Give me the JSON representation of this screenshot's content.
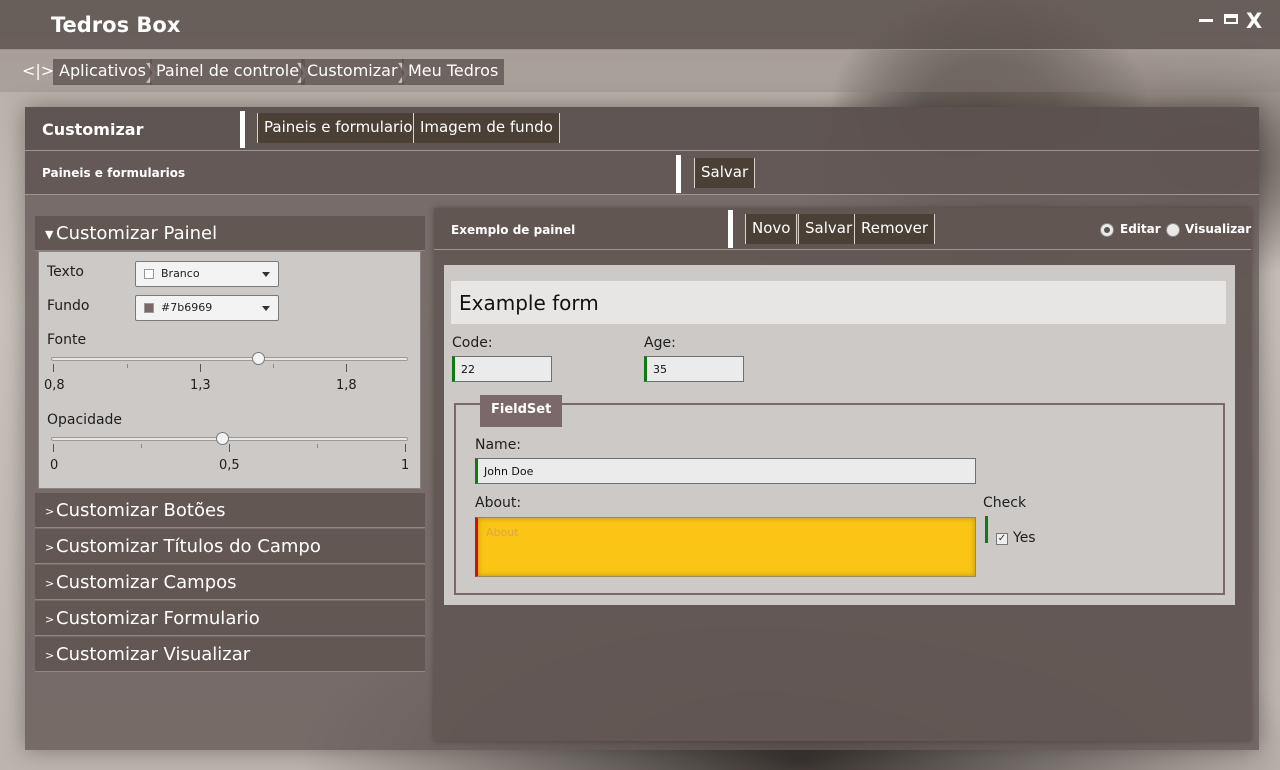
{
  "app": {
    "title": "Tedros Box"
  },
  "window": {
    "minimize": "minimize",
    "maximize": "maximize",
    "close_label": "X"
  },
  "breadcrumb": {
    "back_label": "<|>",
    "items": [
      "Aplicativos",
      "Painel de controle",
      "Customizar",
      "Meu Tedros"
    ]
  },
  "main": {
    "title": "Customizar",
    "tabs": [
      "Paineis e formularios",
      "Imagem de fundo"
    ],
    "subheader": {
      "title": "Paineis e formularios",
      "save_label": "Salvar"
    }
  },
  "left": {
    "expanded_section": {
      "title": "Customizar Painel",
      "texto_label": "Texto",
      "texto_value": "Branco",
      "texto_swatch": "#ffffff",
      "fundo_label": "Fundo",
      "fundo_value": "#7b6969",
      "fundo_swatch": "#7b6969",
      "fonte_label": "Fonte",
      "fonte_ticks": [
        "0,8",
        "1,3",
        "1,8"
      ],
      "fonte_value": 1.5,
      "fonte_min": 0.8,
      "fonte_max": 1.8,
      "opacidade_label": "Opacidade",
      "opacidade_ticks": [
        "0",
        "0,5",
        "1"
      ],
      "opacidade_value": 0.48
    },
    "collapsed_sections": [
      "Customizar Botões",
      "Customizar Títulos do Campo",
      "Customizar Campos",
      "Customizar Formulario",
      "Customizar Visualizar"
    ]
  },
  "panel": {
    "title": "Exemplo de painel",
    "buttons": [
      "Novo",
      "Salvar",
      "Remover"
    ],
    "modes": {
      "edit": "Editar",
      "view": "Visualizar",
      "selected": "edit"
    }
  },
  "form": {
    "title": "Example form",
    "code_label": "Code:",
    "code_value": "22",
    "age_label": "Age:",
    "age_value": "35",
    "fieldset_title": "FieldSet",
    "name_label": "Name:",
    "name_value": "John Doe",
    "about_label": "About:",
    "about_placeholder": "About",
    "check_label": "Check",
    "check_option": "Yes",
    "check_checked": true
  },
  "colors": {
    "panel_bg": "#7b6969",
    "valid_border": "#107a10",
    "invalid_border": "#d10f0f",
    "about_fill": "#fbc515"
  }
}
